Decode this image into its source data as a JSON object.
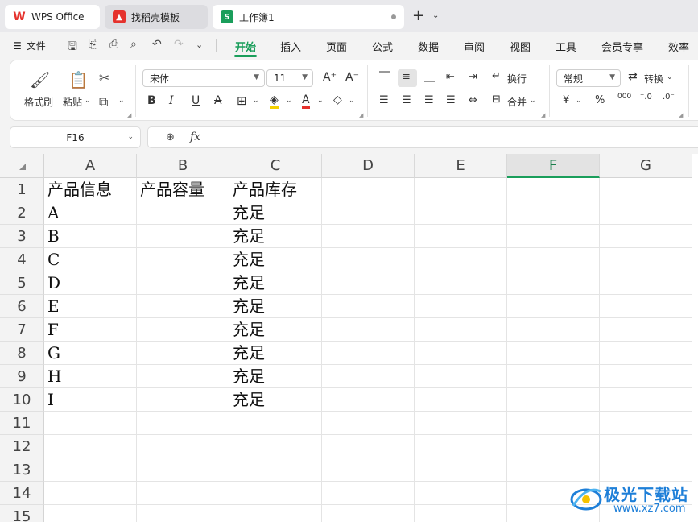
{
  "tabs": [
    {
      "label": "WPS Office",
      "icon": "wps-logo-icon"
    },
    {
      "label": "找稻壳模板",
      "icon": "docer-icon"
    },
    {
      "label": "工作簿1",
      "icon": "spreadsheet-icon",
      "icon_text": "S"
    }
  ],
  "menubar": {
    "file_label": "文件",
    "items": [
      "开始",
      "插入",
      "页面",
      "公式",
      "数据",
      "审阅",
      "视图",
      "工具",
      "会员专享",
      "效率"
    ],
    "active": "开始"
  },
  "ribbon": {
    "format_painter": "格式刷",
    "paste": "粘贴",
    "font_name": "宋体",
    "font_size": "11",
    "wrap": "换行",
    "merge": "合并",
    "number_format": "常规",
    "convert": "转换",
    "currency_symbol": "¥",
    "percent_symbol": "%",
    "thousands_symbol": "000"
  },
  "formula_bar": {
    "name_box": "F16",
    "fx_label": "fx",
    "formula": ""
  },
  "grid": {
    "columns": [
      "A",
      "B",
      "C",
      "D",
      "E",
      "F",
      "G"
    ],
    "selected_column": "F",
    "rows": [
      "1",
      "2",
      "3",
      "4",
      "5",
      "6",
      "7",
      "8",
      "9",
      "10",
      "11",
      "12",
      "13",
      "14",
      "15"
    ],
    "cells": [
      [
        "产品信息",
        "产品容量",
        "产品库存"
      ],
      [
        "A",
        "",
        "充足"
      ],
      [
        "B",
        "",
        "充足"
      ],
      [
        "C",
        "",
        "充足"
      ],
      [
        "D",
        "",
        "充足"
      ],
      [
        "E",
        "",
        "充足"
      ],
      [
        "F",
        "",
        "充足"
      ],
      [
        "G",
        "",
        "充足"
      ],
      [
        "H",
        "",
        "充足"
      ],
      [
        "I",
        "",
        "充足"
      ]
    ]
  },
  "watermark": {
    "title": "极光下载站",
    "url": "www.xz7.com"
  },
  "colors": {
    "accent": "#1a9e5b",
    "wps_red": "#e5322d",
    "watermark_blue": "#1e7fd8"
  }
}
